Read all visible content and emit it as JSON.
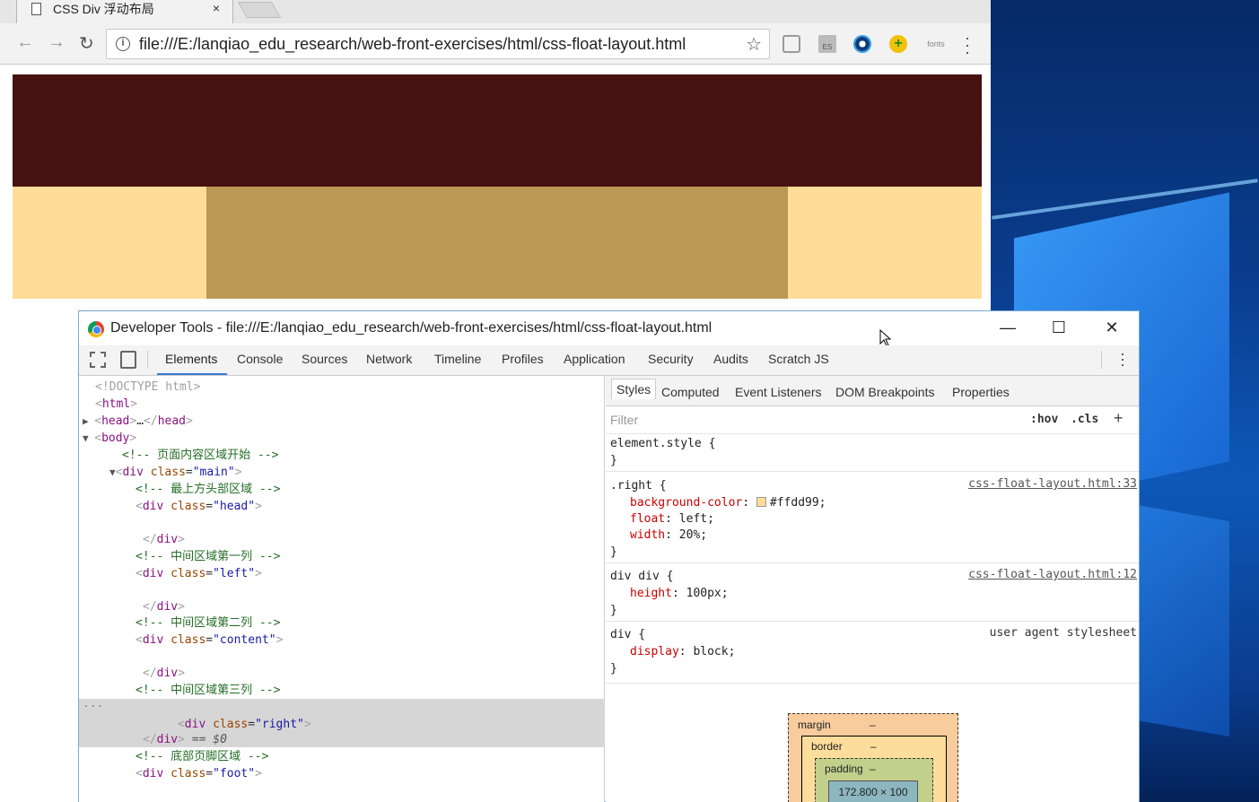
{
  "browser": {
    "tab_title": "CSS Div 浮动布局",
    "tab_close": "×",
    "url": "file:///E:/lanqiao_edu_research/web-front-exercises/html/css-float-layout.html",
    "ext_fonts_label": "fonts",
    "ext_es_label": "ES"
  },
  "page": {
    "colors": {
      "head": "#471111",
      "left": "#ffdd99",
      "content": "#bb9955",
      "right": "#ffdd99"
    }
  },
  "devtools": {
    "title": "Developer Tools - file:///E:/lanqiao_edu_research/web-front-exercises/html/css-float-layout.html",
    "tabs": [
      "Elements",
      "Console",
      "Sources",
      "Network",
      "Timeline",
      "Profiles",
      "Application",
      "Security",
      "Audits",
      "Scratch JS"
    ],
    "active_tab": "Elements",
    "dom": {
      "doctype": "<!DOCTYPE html>",
      "html_tag": "html",
      "head_tag": "head",
      "head_ellipsis": "…",
      "body_tag": "body",
      "comment_page_start": "<!-- 页面内容区域开始 -->",
      "div_tag": "div",
      "class_attr": "class",
      "main_class": "\"main\"",
      "comment_head": "<!-- 最上方头部区域 -->",
      "head_class": "\"head\"",
      "comment_col1": "<!-- 中间区域第一列 -->",
      "left_class": "\"left\"",
      "comment_col2": "<!-- 中间区域第二列 -->",
      "content_class": "\"content\"",
      "comment_col3": "<!-- 中间区域第三列 -->",
      "right_class": "\"right\"",
      "selected_marker": "== $0",
      "comment_foot": "<!-- 底部页脚区域 -->",
      "foot_class": "\"foot\"",
      "gutter_dots": "..."
    },
    "styles": {
      "sub_tabs": [
        "Styles",
        "Computed",
        "Event Listeners",
        "DOM Breakpoints",
        "Properties"
      ],
      "active_sub_tab": "Styles",
      "filter_placeholder": "Filter",
      "hov": ":hov",
      "cls": ".cls",
      "add_label": "+",
      "rules": {
        "element_style": "element.style {",
        "right_selector": ".right {",
        "right_source": "css-float-layout.html:33",
        "bg_prop": "background-color",
        "bg_value": "#ffdd99;",
        "float_prop": "float",
        "float_value": "left;",
        "width_prop": "width",
        "width_value": "20%;",
        "divdiv_selector": "div div {",
        "divdiv_source": "css-float-layout.html:12",
        "height_prop": "height",
        "height_value": "100px;",
        "div_selector": "div {",
        "div_source": "user agent stylesheet",
        "display_prop": "display",
        "display_value": "block;",
        "close_brace": "}"
      }
    },
    "box_model": {
      "margin_label": "margin",
      "border_label": "border",
      "padding_label": "padding",
      "dash": "–",
      "content_size": "172.800 × 100"
    }
  }
}
